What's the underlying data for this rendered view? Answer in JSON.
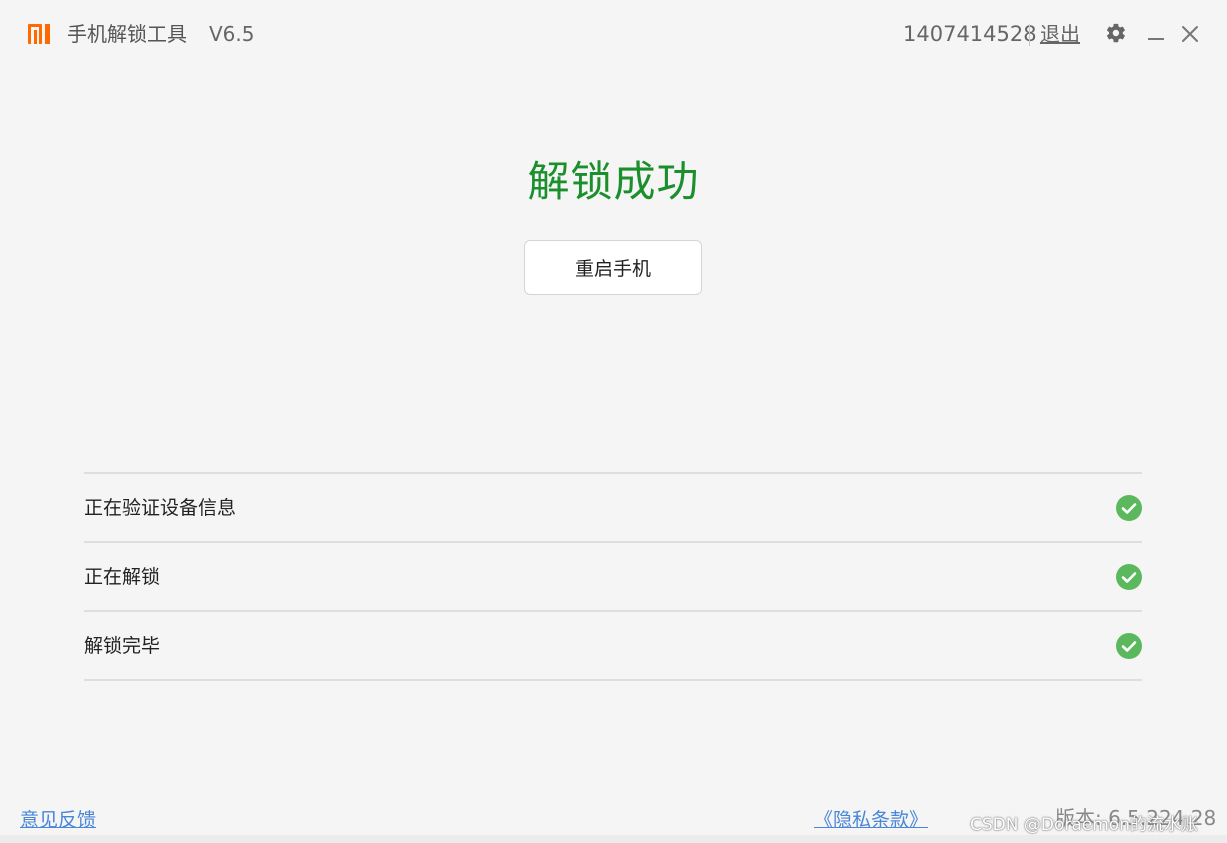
{
  "titlebar": {
    "app_name": "手机解锁工具",
    "version": "V6.5",
    "account_id": "1407414528",
    "logout_label": "退出",
    "brand_color": "#ff6900",
    "icons": [
      "mi-logo",
      "gear-icon",
      "minimize-icon",
      "close-icon"
    ]
  },
  "main": {
    "result_title": "解锁成功",
    "result_color": "#1a8f2c",
    "reboot_button_label": "重启手机"
  },
  "steps": [
    {
      "label": "正在验证设备信息",
      "status": "done",
      "icon": "check-circle-icon"
    },
    {
      "label": "正在解锁",
      "status": "done",
      "icon": "check-circle-icon"
    },
    {
      "label": "解锁完毕",
      "status": "done",
      "icon": "check-circle-icon"
    }
  ],
  "check_color": "#5cb85c",
  "footer": {
    "feedback_label": "意见反馈",
    "privacy_label": "《隐私条款》",
    "version_info": "版本: 6.5.224.28",
    "link_color": "#4a86d8"
  },
  "watermark": "CSDN @Doraemon的流水账"
}
